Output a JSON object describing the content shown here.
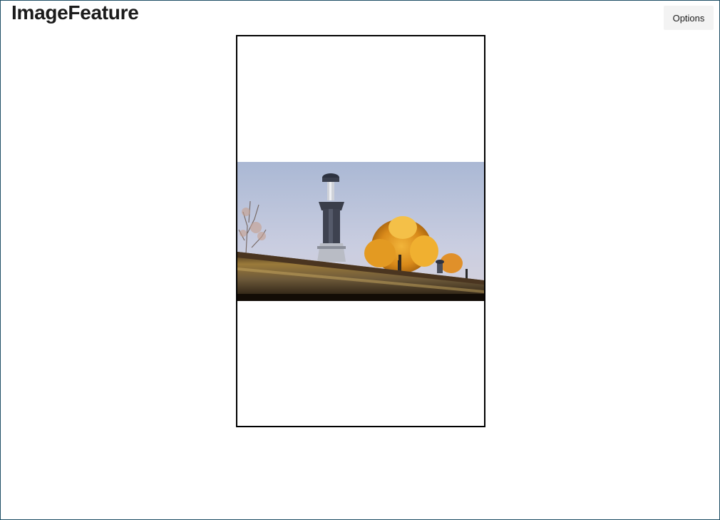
{
  "app": {
    "title": "ImageFeature"
  },
  "toolbar": {
    "options_label": "Options"
  },
  "image": {
    "subject_icon": "chimney-photo-icon"
  }
}
